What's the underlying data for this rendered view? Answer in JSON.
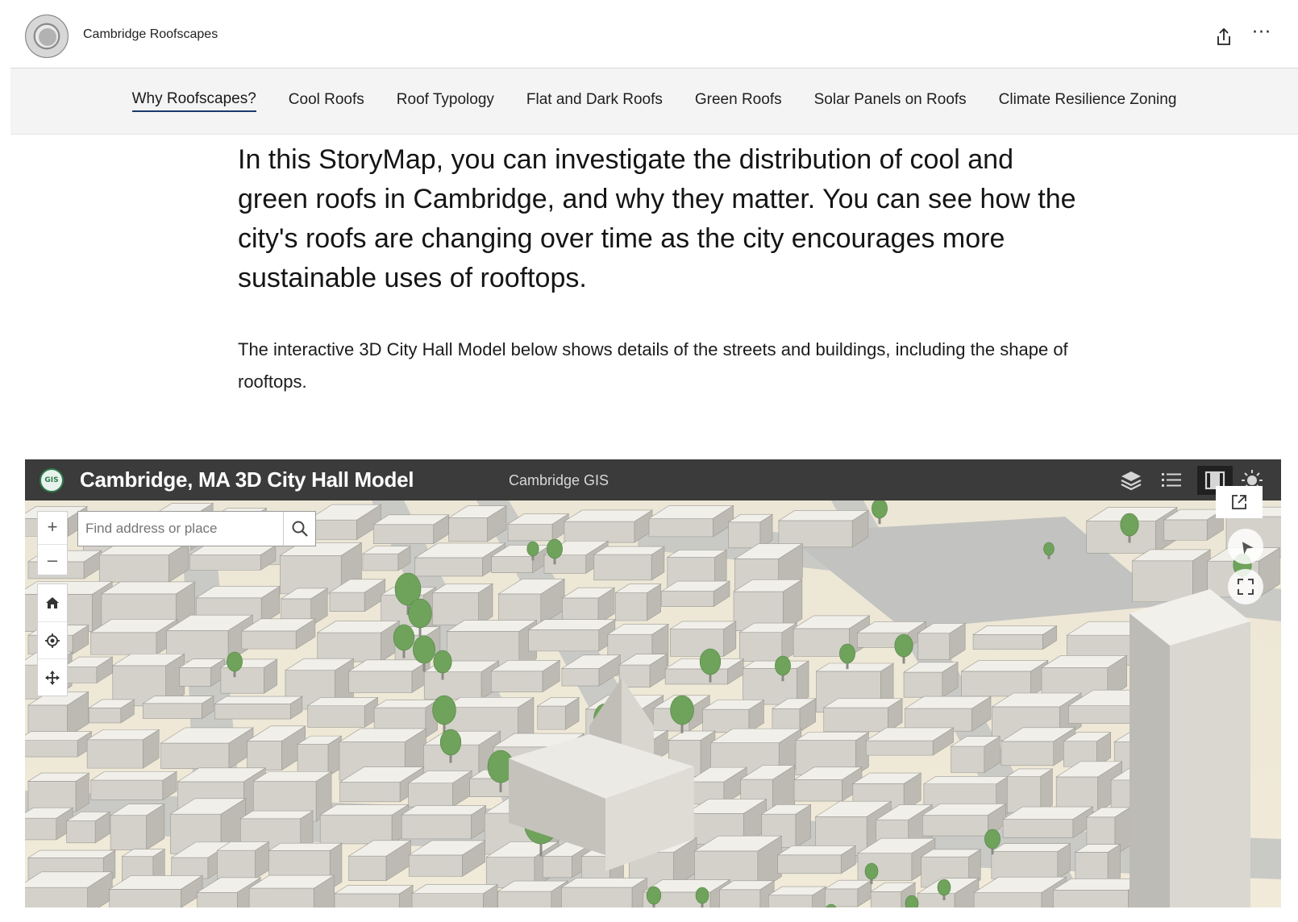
{
  "header": {
    "site_title": "Cambridge Roofscapes",
    "logo": "city-seal",
    "actions": {
      "share_icon": "share-icon",
      "more_icon": "more-icon",
      "more_glyph": "···"
    }
  },
  "nav": {
    "active_index": 0,
    "items": [
      {
        "label": "Why Roofscapes?"
      },
      {
        "label": "Cool Roofs"
      },
      {
        "label": "Roof Typology"
      },
      {
        "label": "Flat and Dark Roofs"
      },
      {
        "label": "Green Roofs"
      },
      {
        "label": "Solar Panels on Roofs"
      },
      {
        "label": "Climate Resilience Zoning"
      }
    ]
  },
  "story": {
    "lede": "In this StoryMap, you can investigate the distribution of cool and green roofs in Cambridge, and why they matter. You can see how the city's roofs are changing over time as the city encourages more sustainable uses of rooftops.",
    "paragraph": "The interactive 3D City Hall Model below shows details of the streets and buildings, including the shape of rooftops."
  },
  "embed": {
    "logo_text": "GIS",
    "title": "Cambridge, MA 3D City Hall Model",
    "subtitle": "Cambridge GIS",
    "header_icons": [
      "layers-icon",
      "legend-icon",
      "basemap-icon",
      "daylight-icon"
    ],
    "search": {
      "placeholder": "Find address or place",
      "value": ""
    },
    "zoom_in": "+",
    "zoom_out": "–",
    "tools": [
      "home-icon",
      "locate-icon",
      "pan-icon"
    ],
    "overlay_icons": [
      "popout-icon",
      "compass-icon",
      "fullscreen-icon"
    ],
    "colors": {
      "header_bg": "#3b3b3b",
      "building": "#e9e7e1",
      "tree": "#6fa35b",
      "ground": "#f3ecd9",
      "street": "#cfcfcd"
    }
  }
}
